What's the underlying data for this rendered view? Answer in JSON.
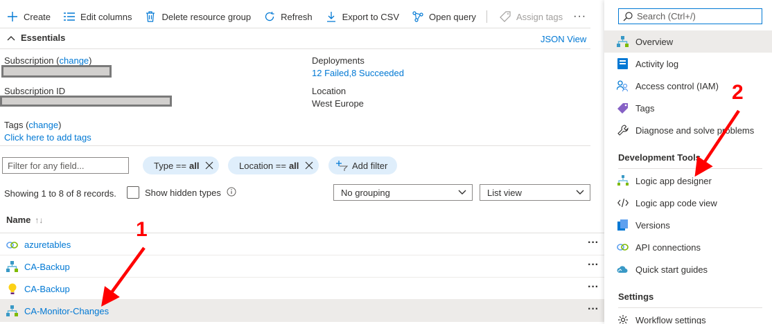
{
  "toolbar": {
    "create": "Create",
    "edit_columns": "Edit columns",
    "delete_rg": "Delete resource group",
    "refresh": "Refresh",
    "export_csv": "Export to CSV",
    "open_query": "Open query",
    "assign_tags": "Assign tags",
    "more": "···"
  },
  "essentials": {
    "title": "Essentials",
    "json_view": "JSON View",
    "subscription_label": "Subscription",
    "change": "change",
    "subscription_id_label": "Subscription ID",
    "tags_label": "Tags",
    "add_tags_link": "Click here to add tags",
    "deployments_label": "Deployments",
    "deployments_value": "12 Failed,8 Succeeded",
    "location_label": "Location",
    "location_value": "West Europe"
  },
  "filters": {
    "placeholder": "Filter for any field...",
    "type_pill_key": "Type ==",
    "type_pill_val": "all",
    "location_pill_key": "Location ==",
    "location_pill_val": "all",
    "add_filter": "Add filter"
  },
  "list": {
    "records": "Showing 1 to 8 of 8 records.",
    "show_hidden": "Show hidden types",
    "grouping": "No grouping",
    "view": "List view",
    "name_col": "Name",
    "more": "···",
    "rows": [
      {
        "name": "azuretables",
        "icon": "api-connection-icon"
      },
      {
        "name": "CA-Backup",
        "icon": "logic-app-icon"
      },
      {
        "name": "CA-Backup",
        "icon": "lightbulb-icon"
      },
      {
        "name": "CA-Monitor-Changes",
        "icon": "logic-app-icon"
      }
    ]
  },
  "sidebar": {
    "search_placeholder": "Search (Ctrl+/)",
    "items": [
      {
        "label": "Overview",
        "icon": "logic-app-icon"
      },
      {
        "label": "Activity log",
        "icon": "activity-log-icon"
      },
      {
        "label": "Access control (IAM)",
        "icon": "people-icon"
      },
      {
        "label": "Tags",
        "icon": "tag-icon"
      },
      {
        "label": "Diagnose and solve problems",
        "icon": "wrench-icon"
      }
    ],
    "section_dev": "Development Tools",
    "dev_items": [
      {
        "label": "Logic app designer",
        "icon": "designer-icon"
      },
      {
        "label": "Logic app code view",
        "icon": "code-icon"
      },
      {
        "label": "Versions",
        "icon": "versions-icon"
      },
      {
        "label": "API connections",
        "icon": "api-connection-icon"
      },
      {
        "label": "Quick start guides",
        "icon": "cloud-icon"
      }
    ],
    "section_settings": "Settings",
    "settings_items": [
      {
        "label": "Workflow settings",
        "icon": "gear-icon"
      }
    ]
  },
  "annotations": {
    "step1": "1",
    "step2": "2"
  },
  "colors": {
    "accent": "#0078d4",
    "annotation": "#ff0000",
    "pill": "#dfeefb",
    "selected_row": "#edebe9"
  }
}
